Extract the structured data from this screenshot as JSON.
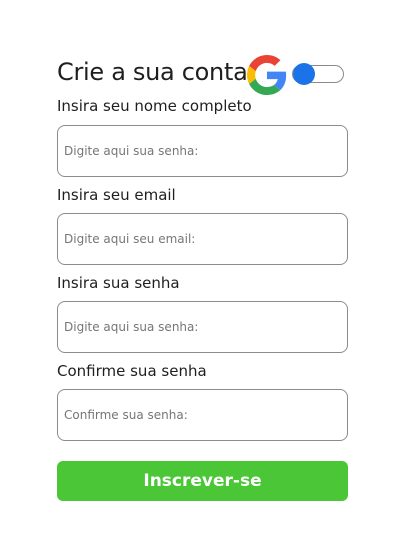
{
  "header": {
    "title": "Crie a sua conta",
    "google_icon": "google-g-logo",
    "toggle_state": "off"
  },
  "fields": [
    {
      "label": "Insira seu nome completo",
      "placeholder": "Digite aqui sua senha:",
      "value": ""
    },
    {
      "label": "Insira seu email",
      "placeholder": "Digite aqui seu email:",
      "value": ""
    },
    {
      "label": "Insira sua senha",
      "placeholder": "Digite aqui sua senha:",
      "value": ""
    },
    {
      "label": "Confirme sua senha",
      "placeholder": "Confirme sua senha:",
      "value": ""
    }
  ],
  "submit": {
    "label": "Inscrever-se"
  },
  "colors": {
    "submit_bg": "#4bc637",
    "toggle_knob": "#1a73e8",
    "input_border": "#8c8c8c"
  }
}
